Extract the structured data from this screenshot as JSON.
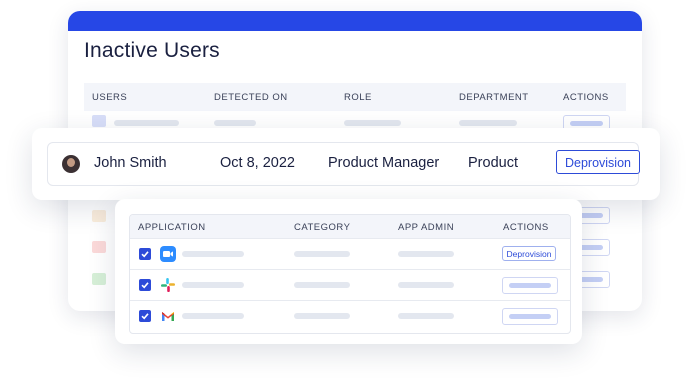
{
  "inactive_users": {
    "title": "Inactive Users",
    "columns": [
      "USERS",
      "DETECTED ON",
      "ROLE",
      "DEPARTMENT",
      "ACTIONS"
    ]
  },
  "user_row": {
    "name": "John Smith",
    "detected_on": "Oct 8, 2022",
    "role": "Product Manager",
    "department": "Product",
    "action": "Deprovision"
  },
  "applications": {
    "columns": [
      "APPLICATION",
      "CATEGORY",
      "APP ADMIN",
      "ACTIONS"
    ],
    "rows": [
      {
        "icon": "zoom-icon",
        "checked": true,
        "action": "Deprovision"
      },
      {
        "icon": "slack-icon",
        "checked": true,
        "action": ""
      },
      {
        "icon": "gmail-icon",
        "checked": true,
        "action": ""
      }
    ]
  },
  "colors": {
    "accent": "#2d4bd8",
    "topbar": "#2647e6",
    "placeholder": "#e3e7ef"
  }
}
